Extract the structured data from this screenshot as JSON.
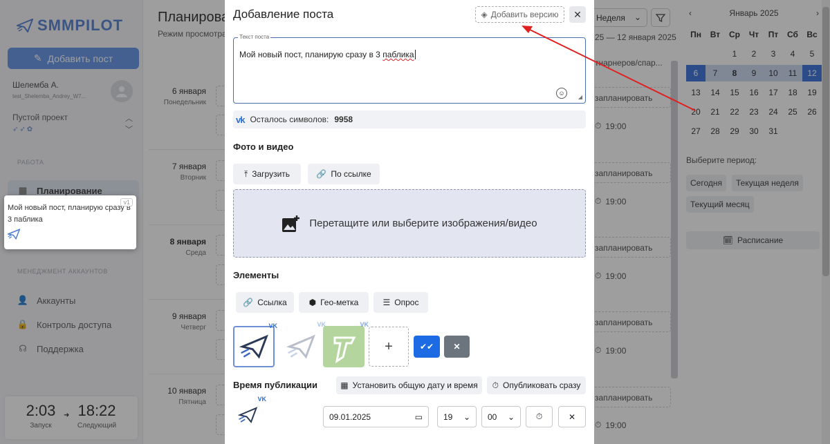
{
  "sidebar": {
    "logo": "SMMPILOT",
    "add_post": "Добавить пост",
    "user_name": "Шелемба А.",
    "user_login": "test_Shelemba_Andrey_W7...",
    "project_name": "Пустой проект",
    "section_work": "РАБОТА",
    "nav_planning": "Планирование",
    "section_accounts": "МЕНЕДЖМЕНТ АККАУНТОВ",
    "nav_accounts": "Аккаунты",
    "nav_access": "Контроль доступа",
    "nav_support": "Поддержка",
    "timer_launch_time": "2:03",
    "timer_launch_label": "Запуск",
    "timer_next_time": "18:22",
    "timer_next_label": "Следующий"
  },
  "main": {
    "title": "Планирова",
    "subtitle": "Режим просмотра",
    "view_select": "Неделя",
    "date_range": "25 — 12 января 2025",
    "partners_text": "тнарнеров/спар...",
    "schedule_label": "запланировать",
    "time_label": "19:00",
    "days": [
      {
        "date": "6 января",
        "name": "Понедельник"
      },
      {
        "date": "7 января",
        "name": "Вторник"
      },
      {
        "date": "8 января",
        "name": "Среда"
      },
      {
        "date": "9 января",
        "name": "Четверг"
      },
      {
        "date": "10 января",
        "name": "Пятница"
      }
    ]
  },
  "calendar": {
    "month": "Январь 2025",
    "weekdays": [
      "Пн",
      "Вт",
      "Ср",
      "Чт",
      "Пт",
      "Сб",
      "Вс"
    ],
    "weeks": [
      [
        "",
        "",
        "1",
        "2",
        "3",
        "4",
        "5"
      ],
      [
        "6",
        "7",
        "8",
        "9",
        "10",
        "11",
        "12"
      ],
      [
        "13",
        "14",
        "15",
        "16",
        "17",
        "18",
        "19"
      ],
      [
        "20",
        "21",
        "22",
        "23",
        "24",
        "25",
        "26"
      ],
      [
        "27",
        "28",
        "29",
        "30",
        "31",
        "",
        ""
      ]
    ],
    "selected_start": "6",
    "selected_end": "12",
    "today": "8",
    "period_label": "Выберите период:",
    "period_today": "Сегодня",
    "period_week": "Текущая неделя",
    "period_month": "Текущий месяц",
    "schedule_button": "Расписание"
  },
  "drag_card": {
    "text": "Мой новый пост, планирую сразу в 3 паблика",
    "version": "v1"
  },
  "modal": {
    "title": "Добавление поста",
    "add_version": "Добавить версию",
    "textarea_label": "Текст поста",
    "post_text_start": "Мой новый пост, планирую сразу в 3 ",
    "post_text_misspelled": "паблика",
    "chars_label": "Осталось символов:",
    "chars_count": "9958",
    "photo_section": "Фото и видео",
    "upload_button": "Загрузить",
    "by_link_button": "По ссылке",
    "dropzone_text": "Перетащите или выберите изображения/видео",
    "elements_section": "Элементы",
    "link_button": "Ссылка",
    "geo_button": "Гео-метка",
    "poll_button": "Опрос",
    "vk_badge": "VK",
    "publish_section": "Время публикации",
    "set_common_datetime": "Установить общую дату и время",
    "publish_now": "Опубликовать сразу",
    "date_value": "09.01.2025",
    "hour_value": "19",
    "minute_value": "00"
  },
  "colors": {
    "accent": "#1d6ae5",
    "vk": "#2a6fd6",
    "annotation_arrow": "#e02020",
    "dropzone_bg": "#e3e6f1"
  }
}
